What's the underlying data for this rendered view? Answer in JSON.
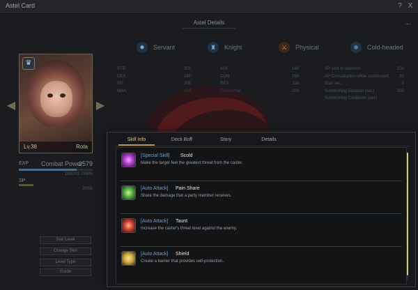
{
  "window": {
    "title": "Astel Card",
    "help_label": "?",
    "close_label": "X"
  },
  "subheader": {
    "title": "Astel Details",
    "back_icon": "back-arrow-icon"
  },
  "character": {
    "level": "Lv.38",
    "name": "Rota",
    "exp_label": "EXP",
    "combat_power_label": "Combat Power",
    "combat_power_value": "2579",
    "exp_values": "185/202.75M%",
    "exp_progress": 0.78,
    "sp_label": "SP",
    "sp_values": "20/65",
    "sp_progress": 0.2
  },
  "left_buttons": [
    "Star Level",
    "Change Skin",
    "Level Type",
    "Guide"
  ],
  "traits": [
    {
      "icon": "servant-icon",
      "label": "Servant",
      "color": "#4a7fb0"
    },
    {
      "icon": "knight-icon",
      "label": "Knight",
      "color": "#4a7fb0"
    },
    {
      "icon": "physical-icon",
      "label": "Physical",
      "color": "#c0823a"
    },
    {
      "icon": "cold-headed-icon",
      "label": "Cold-headed",
      "color": "#4a7fb0"
    }
  ],
  "stats_col1": [
    {
      "name": "STR",
      "value": "303"
    },
    {
      "name": "DEX",
      "value": "180"
    },
    {
      "name": "INT",
      "value": "209"
    },
    {
      "name": "MAN",
      "value": "114"
    }
  ],
  "stats_col2": [
    {
      "name": "AGI",
      "value": "186"
    },
    {
      "name": "CON",
      "value": "268"
    },
    {
      "name": "RES",
      "value": "116"
    },
    {
      "name": "Endurance",
      "value": "209"
    }
  ],
  "stats_col3": [
    {
      "name": "AP cost to summon",
      "value": "100"
    },
    {
      "name": "AP Consumption while summoned",
      "value": "20"
    },
    {
      "name": "Stun sec.",
      "value": "0"
    },
    {
      "name": "Summoning Duration (sec)",
      "value": "300"
    },
    {
      "name": "Summoning Cooldown (sec)",
      "value": ""
    }
  ],
  "tabs": [
    {
      "label": "Skill Info",
      "active": true
    },
    {
      "label": "Deck Buff",
      "active": false
    },
    {
      "label": "Story",
      "active": false
    },
    {
      "label": "Details",
      "active": false
    }
  ],
  "skills": [
    {
      "type": "[Special Skill]",
      "name": "Scold",
      "description": "Make the target feel the greatest threat from the caster.",
      "icon": "scold-skill-icon",
      "color": "#b23fd0"
    },
    {
      "type": "[Auto Attack]",
      "name": "Pain Share",
      "description": "Share the damage that a party member receives.",
      "icon": "pain-share-skill-icon",
      "color": "#4fae3f"
    },
    {
      "type": "[Auto Attack]",
      "name": "Taunt",
      "description": "Increase the caster's threat level against the enemy.",
      "icon": "taunt-skill-icon",
      "color": "#d0432f"
    },
    {
      "type": "[Auto Attack]",
      "name": "Shield",
      "description": "Create a barrier that provides self-protection.",
      "icon": "shield-skill-icon",
      "color": "#d1a93a"
    }
  ]
}
